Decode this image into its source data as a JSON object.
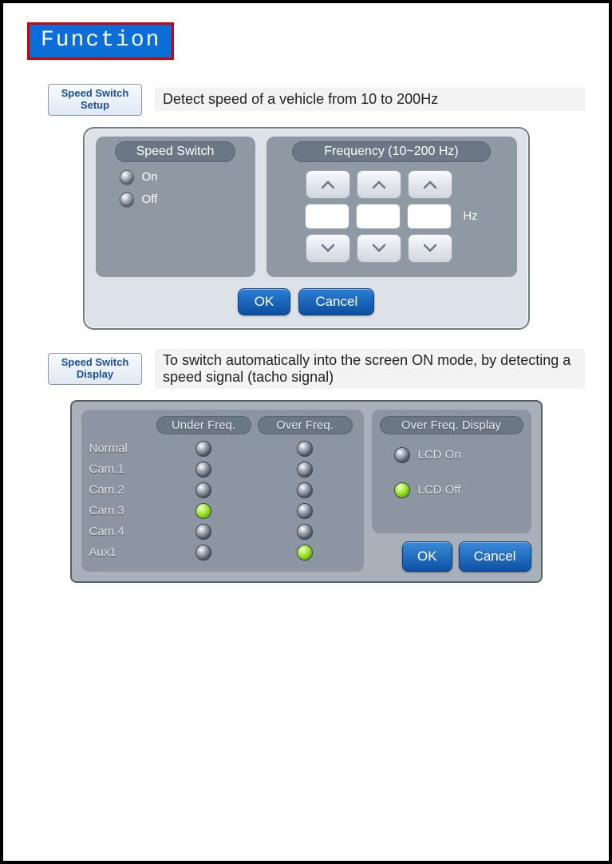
{
  "title": "Function",
  "section1": {
    "button_label": "Speed Switch\nSetup",
    "description": "Detect speed of a vehicle from 10 to 200Hz",
    "dialog": {
      "left_title": "Speed Switch",
      "on_label": "On",
      "off_label": "Off",
      "right_title": "Frequency (10~200 Hz)",
      "hz_label": "Hz",
      "ok": "OK",
      "cancel": "Cancel"
    }
  },
  "section2": {
    "button_label": "Speed Switch\nDisplay",
    "description": "To switch automatically into the screen ON mode, by detecting a speed signal (tacho signal)",
    "dialog": {
      "col_under": "Under Freq.",
      "col_over": "Over Freq.",
      "rows": [
        {
          "label": "Normal",
          "under": false,
          "over": false
        },
        {
          "label": "Cam.1",
          "under": false,
          "over": false
        },
        {
          "label": "Cam.2",
          "under": false,
          "over": false
        },
        {
          "label": "Cam.3",
          "under": true,
          "over": false
        },
        {
          "label": "Cam.4",
          "under": false,
          "over": false
        },
        {
          "label": "Aux1",
          "under": false,
          "over": true
        }
      ],
      "right_title": "Over Freq. Display",
      "lcd_on": "LCD On",
      "lcd_off": "LCD Off",
      "lcd_selected": "off",
      "ok": "OK",
      "cancel": "Cancel"
    }
  }
}
